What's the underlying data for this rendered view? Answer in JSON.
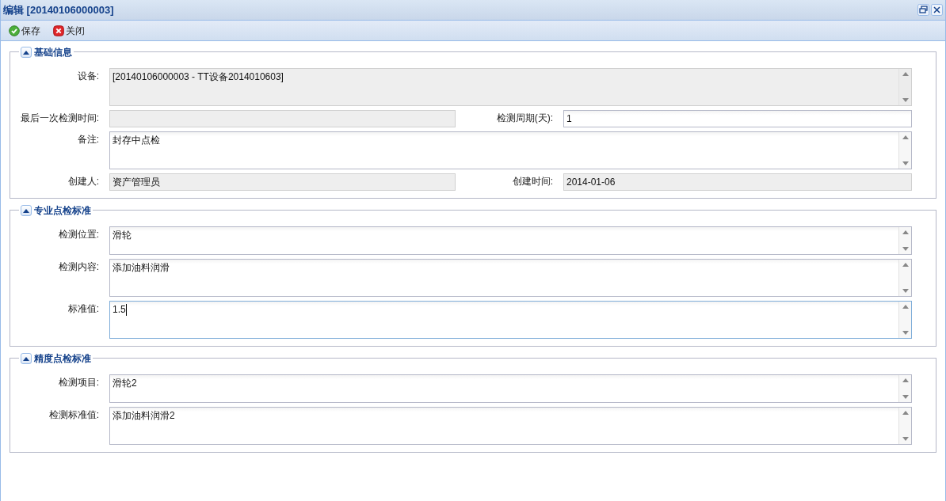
{
  "window": {
    "title": "编辑 [20140106000003]"
  },
  "toolbar": {
    "buttons": [
      {
        "kind": "save",
        "label": "保存"
      },
      {
        "kind": "close",
        "label": "关闭"
      }
    ]
  },
  "sections": [
    {
      "title": "基础信息",
      "expanded": true,
      "rows": [
        [
          {
            "label": "设备:",
            "value": "[20140106000003 - TT设备2014010603]",
            "kind": "textarea",
            "disabled": true,
            "focused": false
          }
        ],
        [
          {
            "label": "最后一次检测时间:",
            "kind": "text",
            "disabled": true,
            "focused": false
          },
          {
            "label": "检测周期(天):",
            "value": "1",
            "kind": "text",
            "disabled": false,
            "focused": false
          }
        ],
        [
          {
            "label": "备注:",
            "value": "封存中点检",
            "kind": "textarea",
            "disabled": false,
            "focused": false
          }
        ],
        [
          {
            "label": "创建人:",
            "value": "资产管理员",
            "kind": "text",
            "disabled": true,
            "focused": false
          },
          {
            "label": "创建时间:",
            "value": "2014-01-06",
            "kind": "text",
            "disabled": true,
            "focused": false
          }
        ]
      ]
    },
    {
      "title": "专业点检标准",
      "expanded": true,
      "rows": [
        [
          {
            "label": "检测位置:",
            "value": "滑轮",
            "kind": "short-textarea",
            "disabled": false,
            "focused": false
          }
        ],
        [
          {
            "label": "检测内容:",
            "value": "添加油料润滑",
            "kind": "textarea",
            "disabled": false,
            "focused": false
          }
        ],
        [
          {
            "label": "标准值:",
            "value": "1.5",
            "kind": "textarea",
            "disabled": false,
            "focused": true
          }
        ]
      ]
    },
    {
      "title": "精度点检标准",
      "expanded": true,
      "rows": [
        [
          {
            "label": "检测项目:",
            "value": "滑轮2",
            "kind": "short-textarea",
            "disabled": false,
            "focused": false
          }
        ],
        [
          {
            "label": "检测标准值:",
            "value": "添加油料润滑2",
            "kind": "textarea",
            "disabled": false,
            "focused": false
          }
        ]
      ]
    }
  ]
}
